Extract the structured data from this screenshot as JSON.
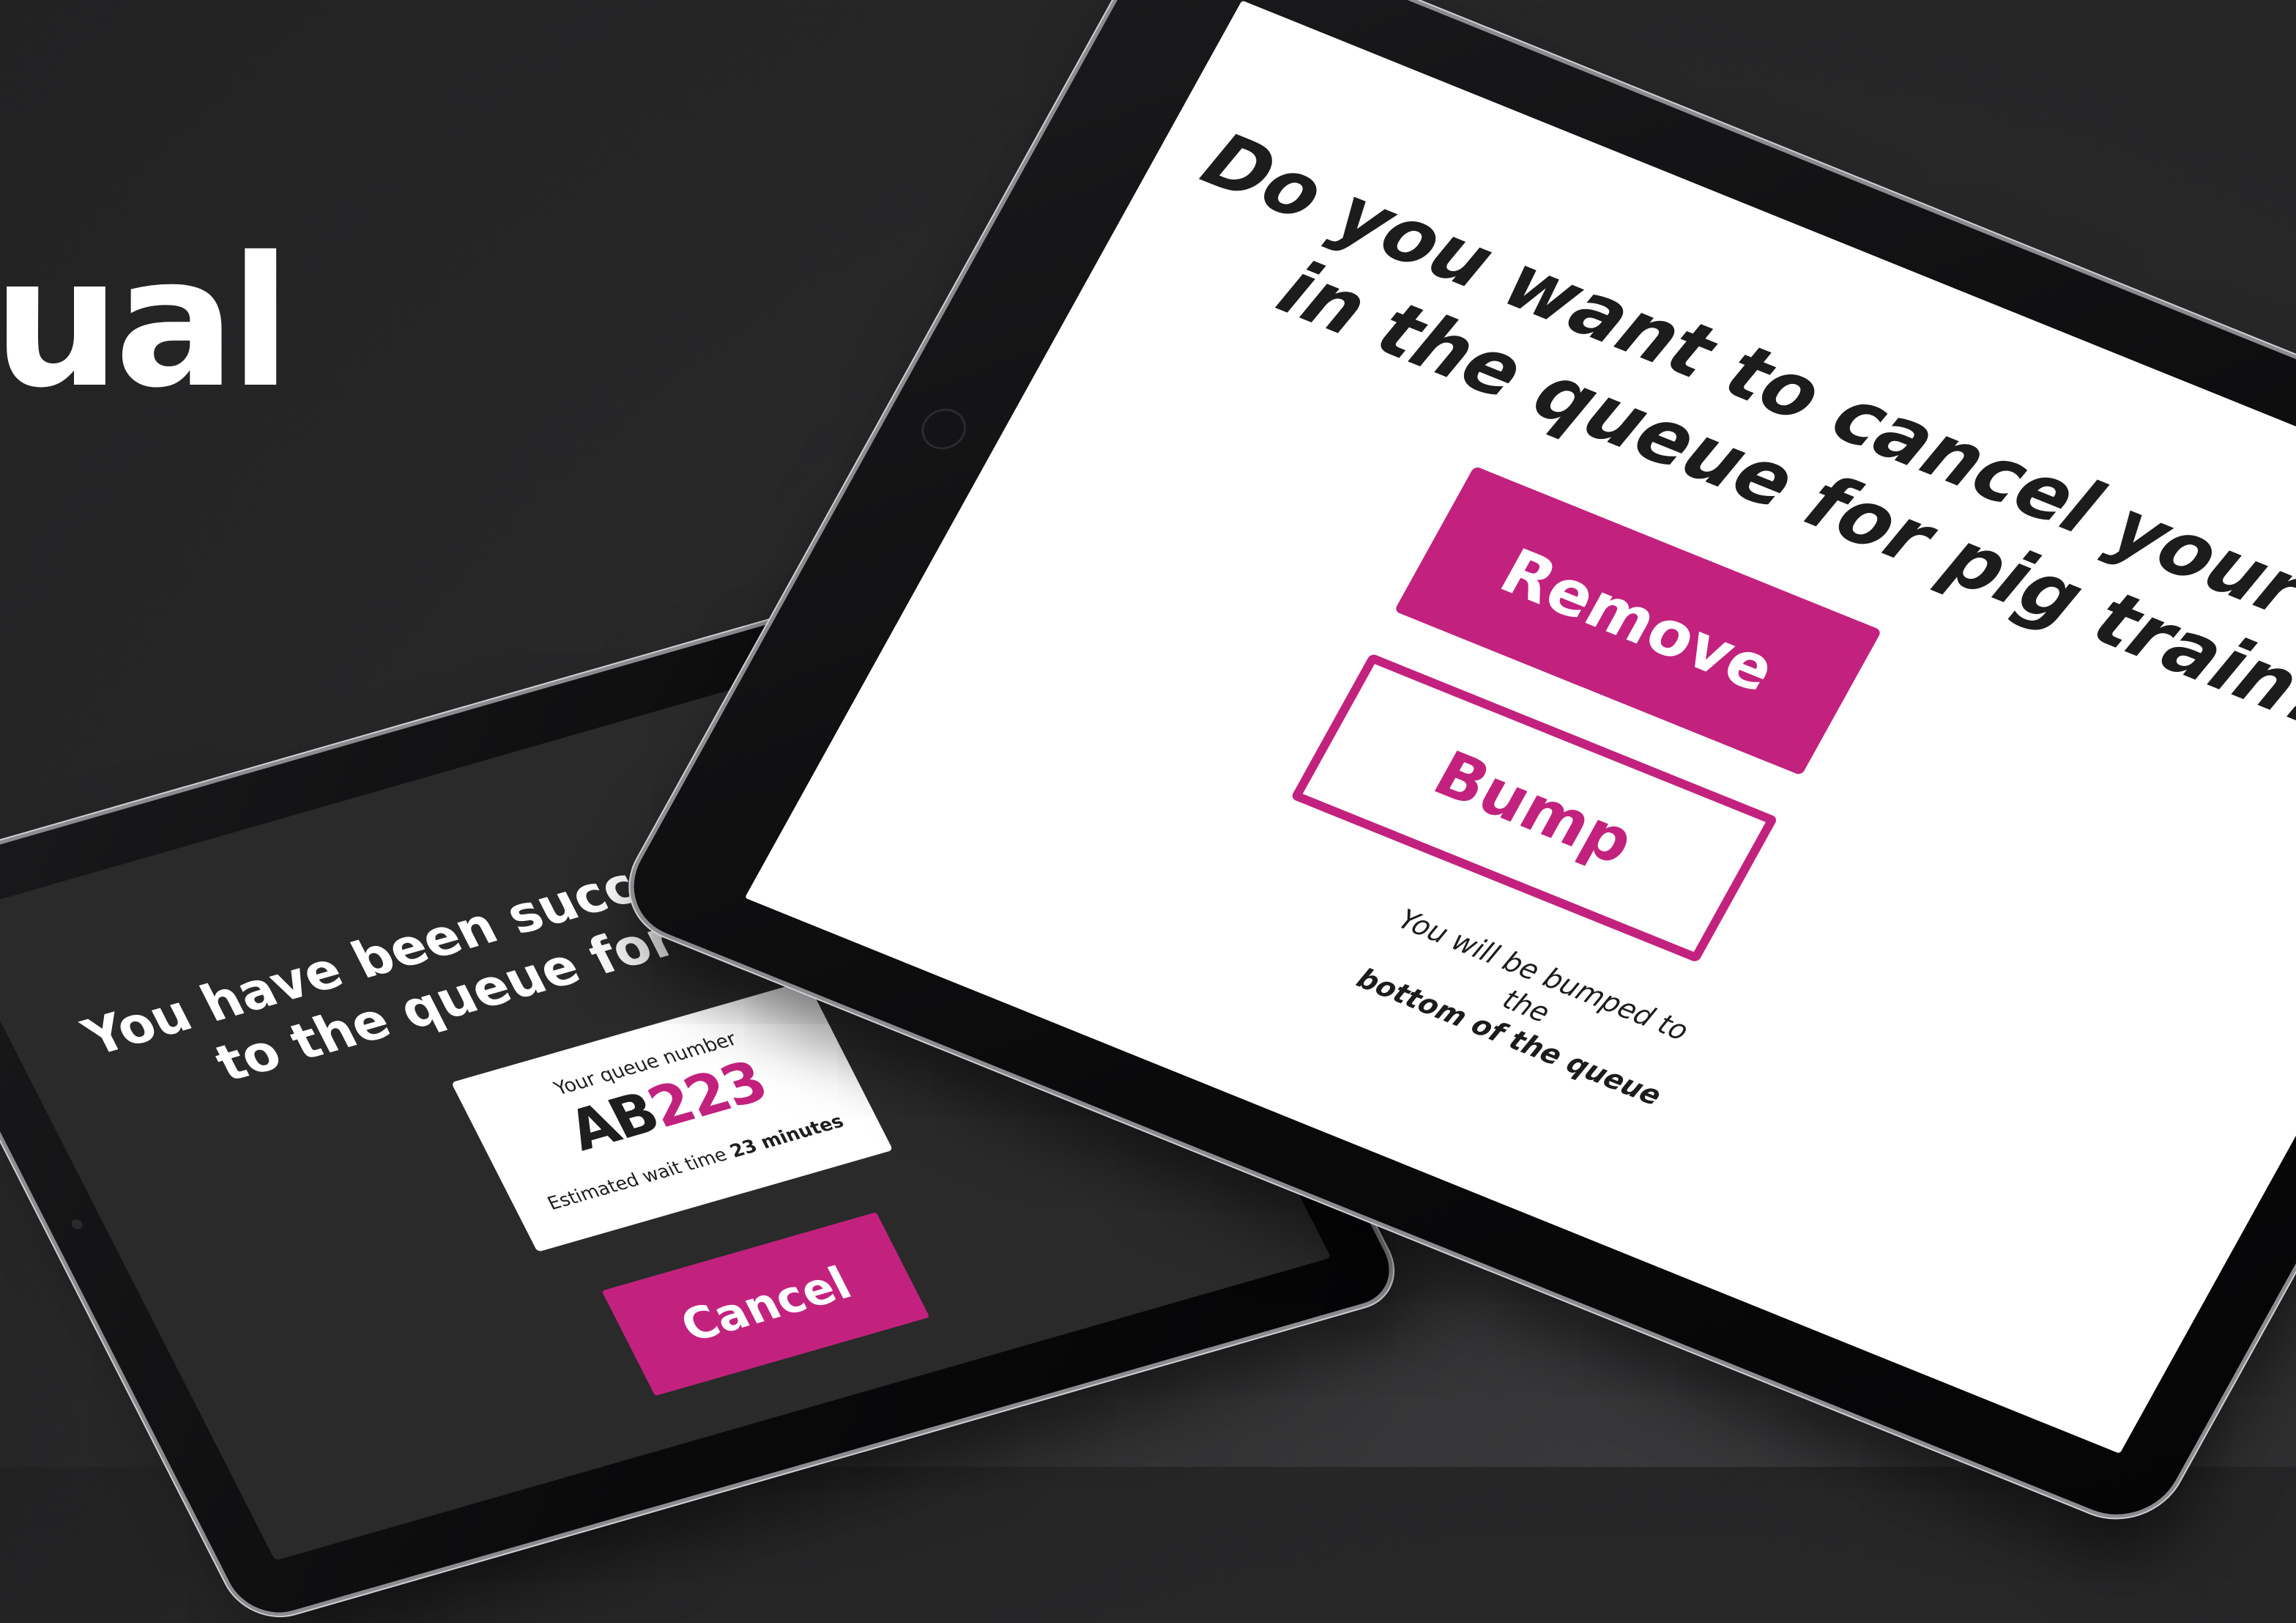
{
  "background": {
    "heading": "ual",
    "color": "#262627"
  },
  "tablet_left": {
    "title_line1": "You have been succesfully added",
    "title_line2": "to the queue for Pig Train",
    "card": {
      "label": "Your queue number",
      "number_prefix": "AB",
      "number_suffix": "223",
      "wait_prefix": "Estimated wait time ",
      "wait_value": "23 minutes"
    },
    "cancel_label": "Cancel",
    "accent_color": "#c2227e"
  },
  "tablet_right": {
    "question_line1": "Do you want to cancel your spot",
    "question_line2": "in the queue for pig train?",
    "remove_label": "Remove",
    "bump_label": "Bump",
    "note_line1": "You will be bumped to",
    "note_prefix": "the ",
    "note_bold": "bottom of the queue",
    "accent_color": "#c2227e",
    "home_button_icon": "home-button-icon"
  }
}
